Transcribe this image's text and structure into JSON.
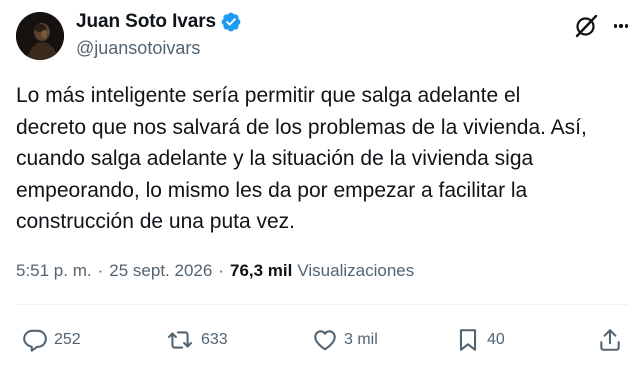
{
  "author": {
    "display_name": "Juan Soto Ivars",
    "handle": "@juansotoivars",
    "verified": true
  },
  "tweet": {
    "text": "Lo más inteligente sería permitir que salga adelante el\ndecreto que nos salvará de los problemas de la vivienda. Así,\ncuando salga adelante y la situación de la vivienda siga\nempeorando, lo mismo les da por empezar a facilitar la\nconstrucción de una puta vez."
  },
  "meta": {
    "time": "5:51 p. m.",
    "separator": "·",
    "date": "25 sept. 2026",
    "views_count": "76,3 mil",
    "views_label": "Visualizaciones"
  },
  "actions": {
    "replies": "252",
    "reposts": "633",
    "likes": "3 mil",
    "bookmarks": "40"
  },
  "icons": {
    "verified": "verified-badge-icon",
    "grok": "grok-icon",
    "more": "more-icon",
    "reply": "reply-icon",
    "repost": "repost-icon",
    "like": "heart-icon",
    "bookmark": "bookmark-icon",
    "share": "share-icon"
  },
  "colors": {
    "verified": "#1d9bf0",
    "text": "#0f1419",
    "muted": "#536471"
  }
}
